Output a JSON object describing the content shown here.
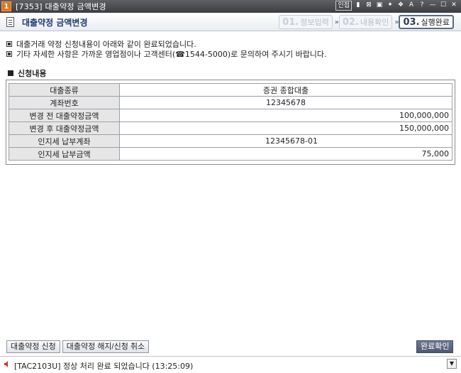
{
  "window": {
    "screen_no": "1",
    "title": "[7353] 대출약정 금액변경",
    "controls": [
      "인접",
      "▮",
      "⊠",
      "▣",
      "✦",
      "❖",
      "A",
      "?",
      "—",
      "☐",
      "✕"
    ]
  },
  "header": {
    "title": "대출약정 금액변경",
    "steps": [
      {
        "num": "01.",
        "label": "정보입력"
      },
      {
        "num": "02.",
        "label": "내용확인"
      },
      {
        "num": "03.",
        "label": "실행완료"
      }
    ],
    "arrow": "»"
  },
  "notices": [
    "대출거래 약정 신청내용이 아래와 같이 완료되었습니다.",
    "기타 자세한 사항은 가까운 영업점이나 고객센터(☎1544-5000)로 문의하여 주시기 바랍니다."
  ],
  "section": {
    "title": "신청내용"
  },
  "details": {
    "rows": [
      {
        "label": "대출종류",
        "value": "증권 종합대출"
      },
      {
        "label": "계좌번호",
        "value": "12345678"
      },
      {
        "label": "변경 전 대출약정금액",
        "value": "100,000,000"
      },
      {
        "label": "변경 후 대출약정금액",
        "value": "150,000,000"
      },
      {
        "label": "인지세 납부계좌",
        "value": "12345678-01"
      },
      {
        "label": "인지세 납부금액",
        "value": "75,000"
      }
    ]
  },
  "buttons": {
    "apply": "대출약정 신청",
    "cancel": "대출약정 해지/신청 취소",
    "confirm": "완료확인"
  },
  "status": {
    "message": "[TAC2103U] 정상 처리 완료 되었습니다 (13:25:09)"
  },
  "colors": {
    "accent": "#1f3a6e",
    "titlebar": "#4a4b50",
    "confirm_button": "#5a6880",
    "screen_badge": "#e2731f"
  }
}
